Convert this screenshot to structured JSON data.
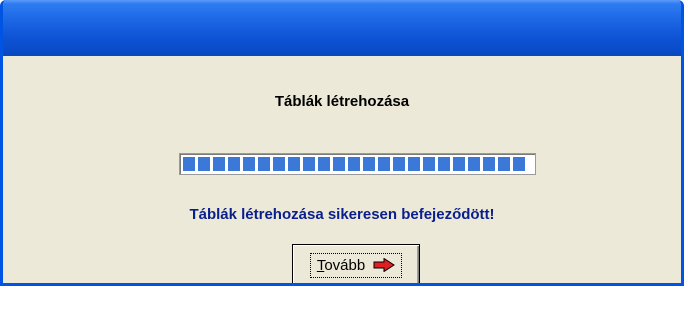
{
  "dialog": {
    "heading": "Táblák létrehozása",
    "progress_fraction": 1.0,
    "status_text": "Táblák létrehozása sikeresen befejeződött!",
    "next_button": {
      "mnemonic": "T",
      "label_rest": "ovább",
      "icon": "arrow-right-icon"
    }
  },
  "colors": {
    "titlebar": "#0a5fd8",
    "window_background": "#ece9d8",
    "progress_fill": "#3c78d8",
    "status_text": "#0a1f8e",
    "arrow": "#e02020"
  }
}
